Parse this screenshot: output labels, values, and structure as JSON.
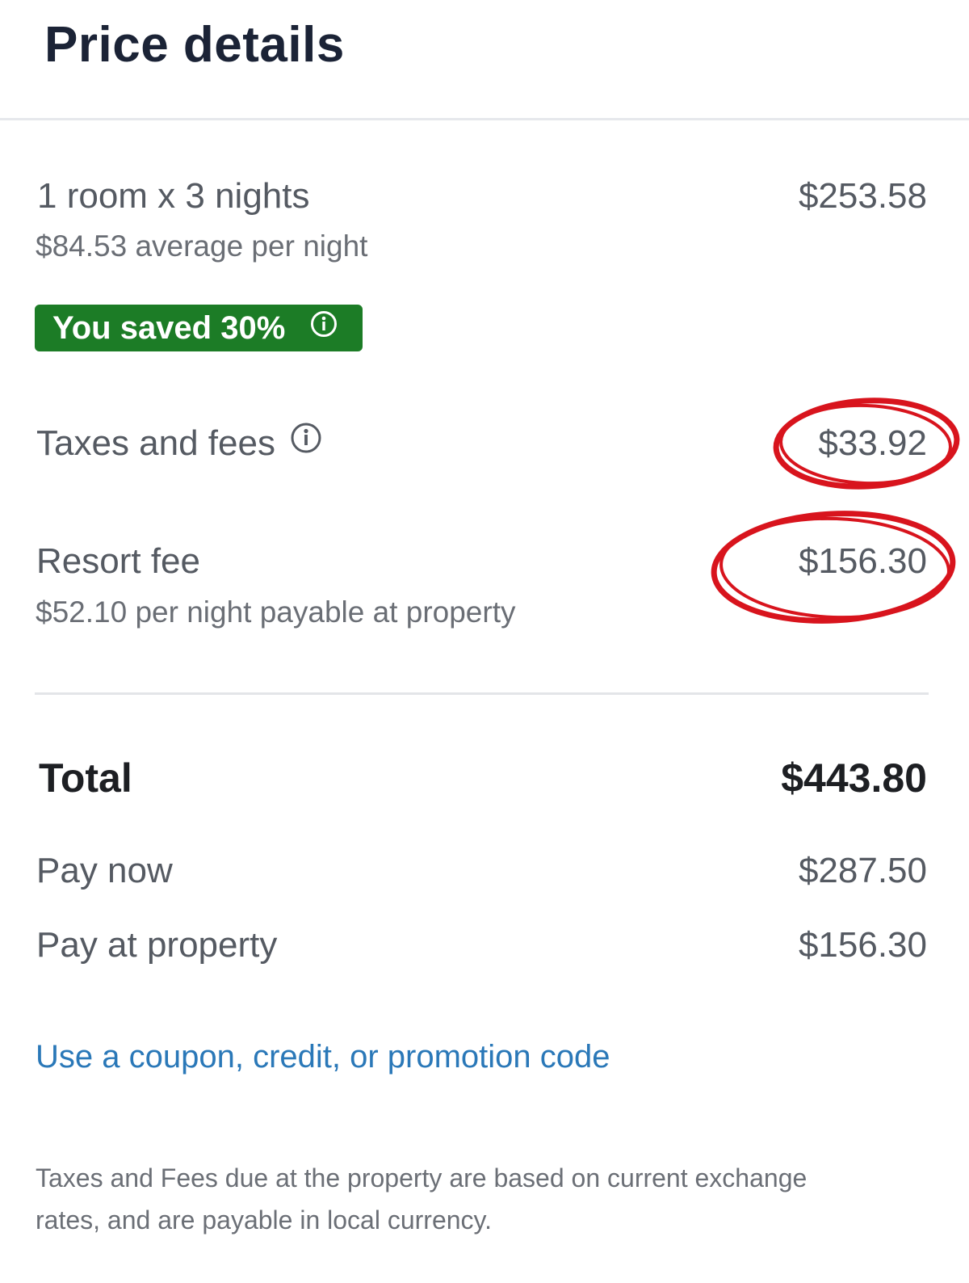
{
  "header": {
    "title": "Price details"
  },
  "room": {
    "label": "1 room x 3 nights",
    "amount": "$253.58",
    "average": "$84.53 average per night",
    "savings_badge": "You saved 30%"
  },
  "taxes": {
    "label": "Taxes and fees",
    "amount": "$33.92"
  },
  "resort_fee": {
    "label": "Resort fee",
    "amount": "$156.30",
    "detail": "$52.10 per night payable at property"
  },
  "total": {
    "label": "Total",
    "amount": "$443.80"
  },
  "pay_now": {
    "label": "Pay now",
    "amount": "$287.50"
  },
  "pay_at_property": {
    "label": "Pay at property",
    "amount": "$156.30"
  },
  "coupon_link": "Use a coupon, credit, or promotion code",
  "disclaimer": "Taxes and Fees due at the property are based on current exchange rates, and are payable in local currency.",
  "colors": {
    "badge_green": "#1c7c26",
    "link_blue": "#2a78b8",
    "annotation_red": "#d8141d"
  },
  "icons": [
    "info-icon"
  ]
}
